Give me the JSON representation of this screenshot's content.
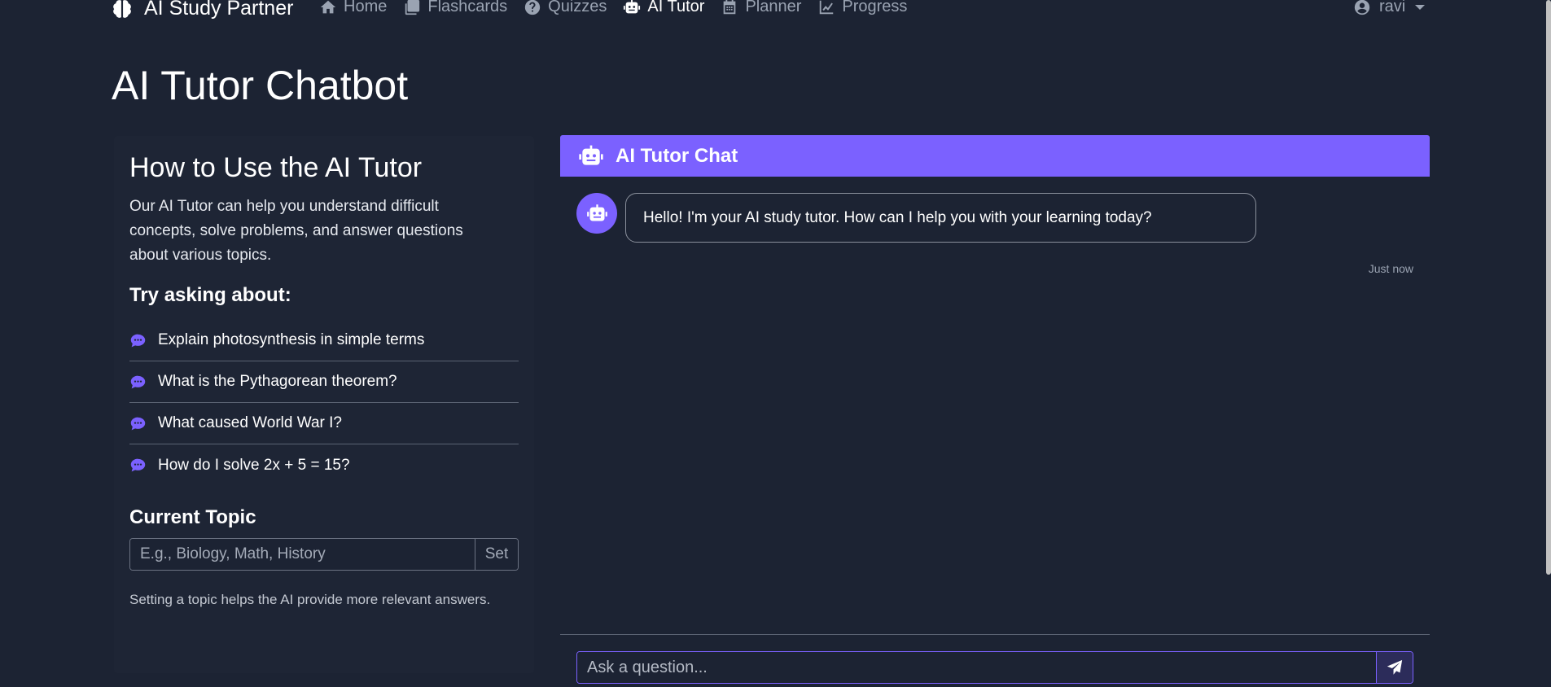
{
  "navbar": {
    "brand": "AI Study Partner",
    "brand_icon": "brain-icon",
    "links": [
      {
        "label": "Home",
        "icon": "home-icon",
        "active": false
      },
      {
        "label": "Flashcards",
        "icon": "flashcards-icon",
        "active": false
      },
      {
        "label": "Quizzes",
        "icon": "question-circle-icon",
        "active": false
      },
      {
        "label": "AI Tutor",
        "icon": "robot-icon",
        "active": true
      },
      {
        "label": "Planner",
        "icon": "calendar-icon",
        "active": false
      },
      {
        "label": "Progress",
        "icon": "chart-line-icon",
        "active": false
      }
    ],
    "user": {
      "name": "ravi",
      "icon": "user-circle-icon"
    }
  },
  "page": {
    "title": "AI Tutor Chatbot"
  },
  "sidebar": {
    "heading": "How to Use the AI Tutor",
    "intro": "Our AI Tutor can help you understand difficult concepts, solve problems, and answer questions about various topics.",
    "try_heading": "Try asking about:",
    "suggestions": [
      "Explain photosynthesis in simple terms",
      "What is the Pythagorean theorem?",
      "What caused World War I?",
      "How do I solve 2x + 5 = 15?"
    ],
    "topic": {
      "heading": "Current Topic",
      "placeholder": "E.g., Biology, Math, History",
      "value": "",
      "set_label": "Set",
      "help": "Setting a topic helps the AI provide more relevant answers."
    }
  },
  "chat": {
    "header": "AI Tutor Chat",
    "messages": [
      {
        "sender": "bot",
        "text": "Hello! I'm your AI study tutor. How can I help you with your learning today?",
        "time": "Just now"
      }
    ],
    "input": {
      "placeholder": "Ask a question...",
      "value": ""
    }
  },
  "colors": {
    "background": "#1c2333",
    "accent": "#7b61ff",
    "muted_text": "#9aa3b2"
  }
}
